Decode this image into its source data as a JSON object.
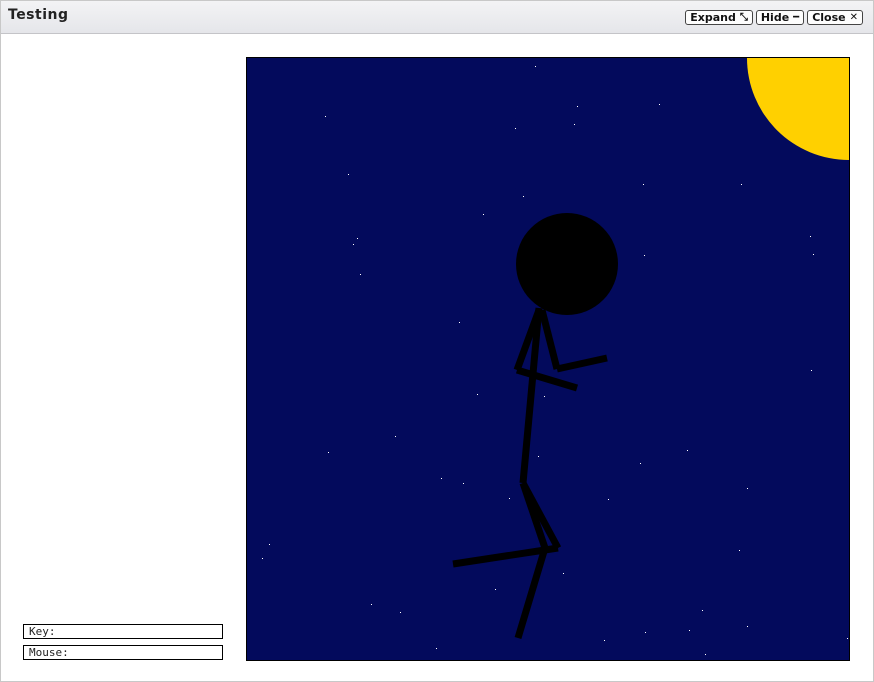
{
  "window": {
    "title": "Testing",
    "buttons": [
      {
        "label": "Expand",
        "icon": "expand-icon",
        "glyph": "⤡"
      },
      {
        "label": "Hide",
        "icon": "minus-icon",
        "glyph": "━"
      },
      {
        "label": "Close",
        "icon": "close-icon",
        "glyph": "✕"
      }
    ]
  },
  "readouts": {
    "key_label": "Key:",
    "mouse_label": "Mouse:"
  },
  "scene": {
    "sky_color": "#030a5c",
    "sun_color": "#ffd000",
    "figure_color": "#000000",
    "star_color": "#ffffff"
  }
}
